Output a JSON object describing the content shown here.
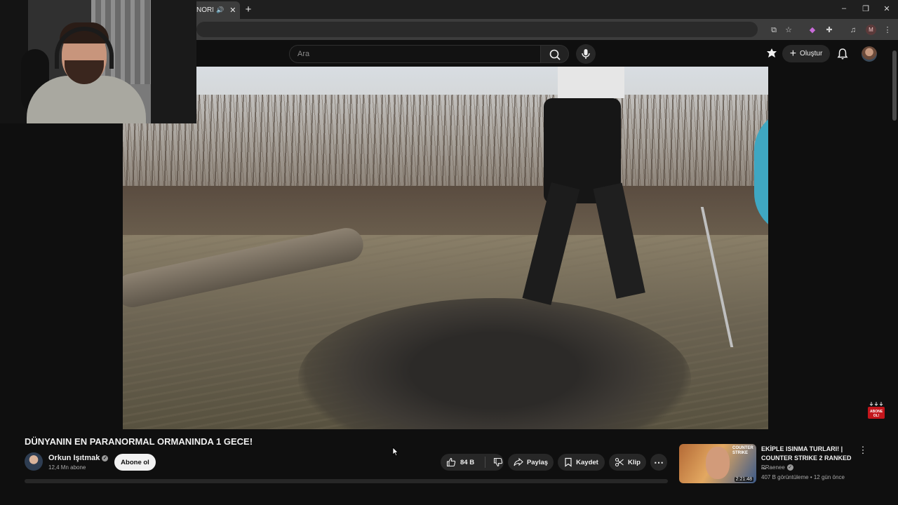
{
  "browser": {
    "tab_title": "NORM",
    "new_tab_label": "+",
    "profile_initial": "M"
  },
  "youtube": {
    "search": {
      "placeholder": "Ara"
    },
    "create_label": "Oluştur"
  },
  "video": {
    "title": "DÜNYANIN EN PARANORMAL ORMANINDA 1 GECE!",
    "channel": {
      "name": "Orkun Işıtmak",
      "subscribers": "12,4 Mn abone",
      "subscribe_label": "Abone ol"
    },
    "actions": {
      "likes": "84 B",
      "share": "Paylaş",
      "save": "Kaydet",
      "clip": "Klip"
    },
    "badge_text": "ABONE OL!"
  },
  "recommendation": {
    "title": "EKİPLE ISINMA TURLARI! | COUNTER STRIKE 2 RANKED ...",
    "channel": "RRaenee",
    "meta": "407 B görüntüleme • 12 gün önce",
    "thumb_text": "COUNTER STRIKE",
    "duration": "2:21:48"
  },
  "colors": {
    "background": "#0f0f0f",
    "pill": "#272727",
    "text": "#f1f1f1",
    "muted": "#aaaaaa",
    "subscribe_bg": "#f1f1f1"
  }
}
